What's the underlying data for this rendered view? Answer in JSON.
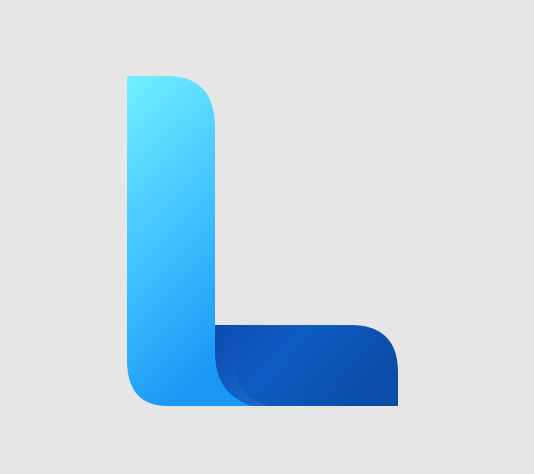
{
  "logo": {
    "icon": "letter-l-logo-icon",
    "background_color": "#e6e6e6",
    "colors": {
      "vertical_top": "#74efff",
      "vertical_mid": "#3fc1ff",
      "vertical_bottom": "#1a98f5",
      "horizontal_dark": "#0b4eb2",
      "horizontal_mid": "#0f5cc2",
      "horizontal_light": "#1e6fd4",
      "fold_shadow": "#0a49ab"
    }
  }
}
